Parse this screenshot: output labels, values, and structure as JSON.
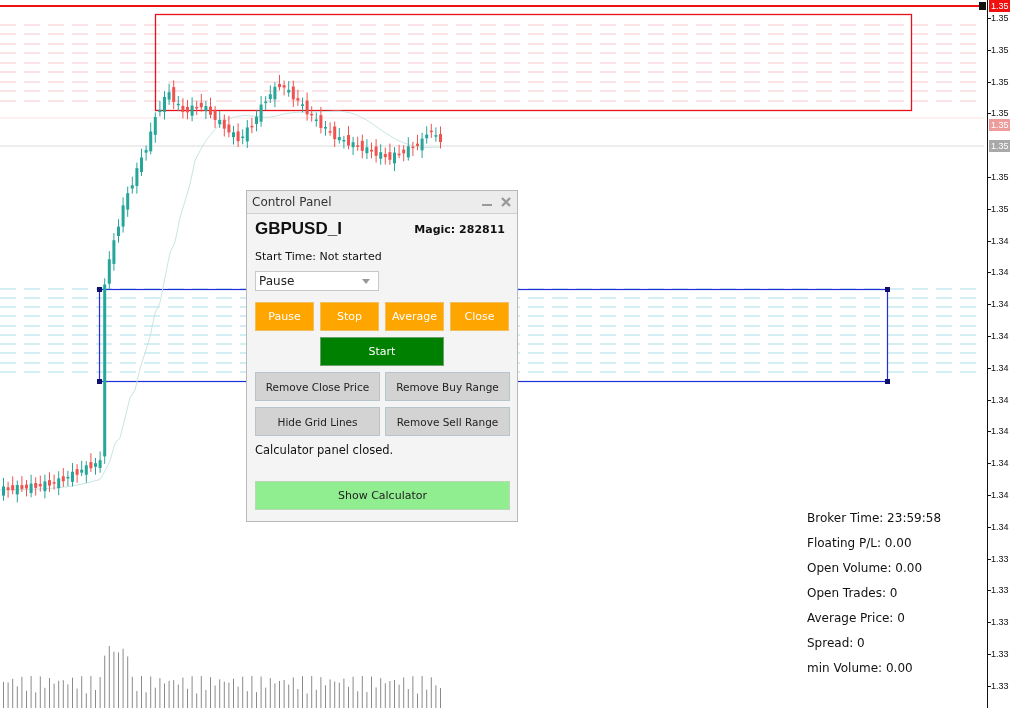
{
  "price_axis": {
    "ticks": [
      "1.35",
      "1.35",
      "1.35",
      "1.35",
      "1.35",
      "1.35",
      "1.34",
      "1.34",
      "1.34",
      "1.34",
      "1.34",
      "1.34",
      "1.34",
      "1.34",
      "1.34",
      "1.34",
      "1.33",
      "1.33",
      "1.33",
      "1.33",
      "1.33"
    ],
    "tags": [
      {
        "text": "1.35",
        "kind": "price"
      },
      {
        "text": "1.35",
        "kind": "range"
      },
      {
        "text": "1.35",
        "kind": "bid"
      }
    ]
  },
  "control_panel": {
    "title": "Control Panel",
    "symbol": "GBPUSD_I",
    "magic": "Magic: 282811",
    "start_time": "Start Time: Not started",
    "mode_select": {
      "value": "Pause"
    },
    "action_buttons": [
      "Pause",
      "Stop",
      "Average",
      "Close"
    ],
    "start_button": "Start",
    "tool_buttons": [
      "Remove Close Price",
      "Remove Buy Range",
      "Hide Grid Lines",
      "Remove Sell Range"
    ],
    "status": "Calculator panel closed.",
    "calculator_button": "Show Calculator"
  },
  "info_lines": [
    "Broker Time: 23:59:58",
    "Floating P/L: 0.00",
    "Open Volume: 0.00",
    "Open Trades: 0",
    "Average Price: 0",
    "Spread: 0",
    "min Volume: 0.00"
  ]
}
